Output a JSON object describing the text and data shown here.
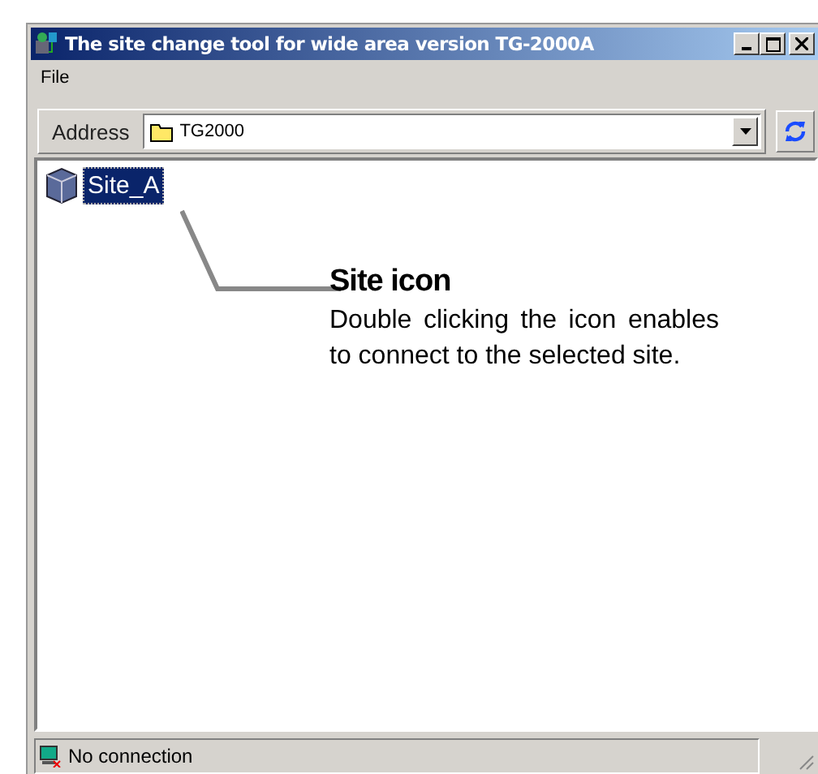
{
  "window": {
    "title": "The site change tool for wide area version TG-2000A"
  },
  "menu": [
    "File"
  ],
  "address_bar": {
    "label": "Address",
    "value": "TG2000"
  },
  "items": [
    {
      "label": "Site_A",
      "selected": true
    }
  ],
  "callout": {
    "title": "Site icon",
    "text": "Double clicking the icon enables to connect to the selected site."
  },
  "status_bar": {
    "text": "No connection"
  }
}
